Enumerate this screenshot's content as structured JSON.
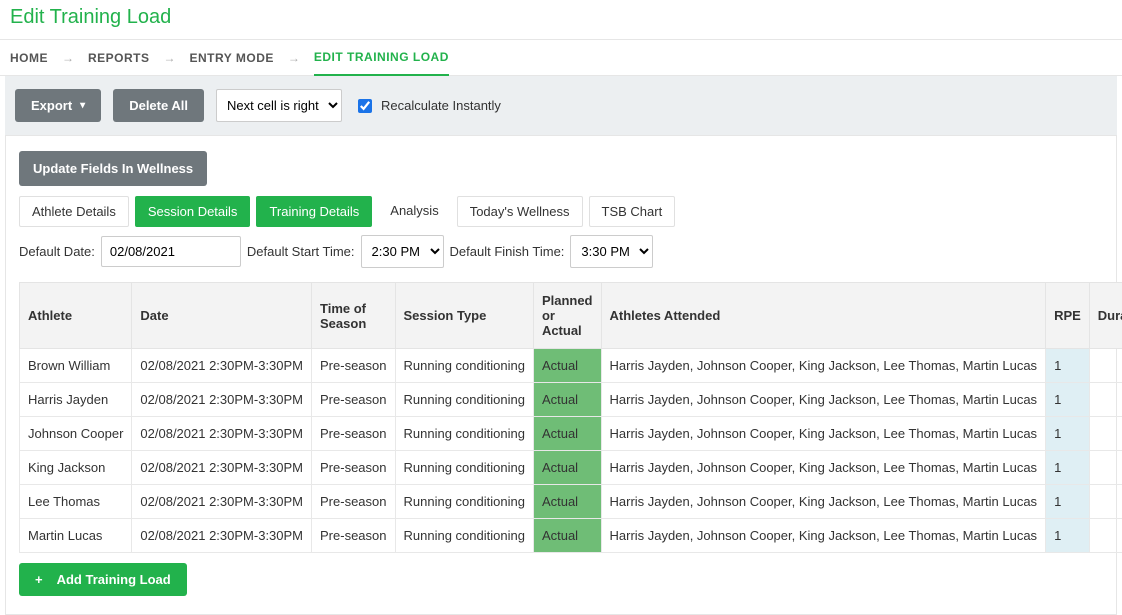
{
  "page_title": "Edit Training Load",
  "breadcrumb": {
    "home": "HOME",
    "reports": "REPORTS",
    "entry_mode": "ENTRY MODE",
    "edit": "EDIT TRAINING LOAD"
  },
  "toolbar": {
    "export_label": "Export",
    "delete_all_label": "Delete All",
    "next_cell_option": "Next cell is right",
    "recalc_label": "Recalculate Instantly"
  },
  "panel": {
    "update_btn": "Update Fields In Wellness",
    "tabs": {
      "athlete_details": "Athlete Details",
      "session_details": "Session Details",
      "training_details": "Training Details",
      "analysis": "Analysis",
      "today_wellness": "Today's Wellness",
      "tsb_chart": "TSB Chart"
    },
    "defaults": {
      "date_label": "Default Date:",
      "date_value": "02/08/2021",
      "start_label": "Default Start Time:",
      "start_value": "2:30 PM",
      "finish_label": "Default Finish Time:",
      "finish_value": "3:30 PM"
    }
  },
  "table": {
    "headers": {
      "athlete": "Athlete",
      "date": "Date",
      "time_of_season": "Time of Season",
      "session_type": "Session Type",
      "planned_actual": "Planned or Actual",
      "athletes_attended": "Athletes Attended",
      "rpe": "RPE",
      "duration": "Duration"
    },
    "rows": [
      {
        "athlete": "Brown William",
        "date": "02/08/2021 2:30PM-3:30PM",
        "tos": "Pre-season",
        "stype": "Running conditioning",
        "pa": "Actual",
        "att": "Harris Jayden, Johnson Cooper, King Jackson, Lee Thomas, Martin Lucas",
        "rpe": "1",
        "dur": ""
      },
      {
        "athlete": "Harris Jayden",
        "date": "02/08/2021 2:30PM-3:30PM",
        "tos": "Pre-season",
        "stype": "Running conditioning",
        "pa": "Actual",
        "att": "Harris Jayden, Johnson Cooper, King Jackson, Lee Thomas, Martin Lucas",
        "rpe": "1",
        "dur": ""
      },
      {
        "athlete": "Johnson Cooper",
        "date": "02/08/2021 2:30PM-3:30PM",
        "tos": "Pre-season",
        "stype": "Running conditioning",
        "pa": "Actual",
        "att": "Harris Jayden, Johnson Cooper, King Jackson, Lee Thomas, Martin Lucas",
        "rpe": "1",
        "dur": ""
      },
      {
        "athlete": "King Jackson",
        "date": "02/08/2021 2:30PM-3:30PM",
        "tos": "Pre-season",
        "stype": "Running conditioning",
        "pa": "Actual",
        "att": "Harris Jayden, Johnson Cooper, King Jackson, Lee Thomas, Martin Lucas",
        "rpe": "1",
        "dur": ""
      },
      {
        "athlete": "Lee Thomas",
        "date": "02/08/2021 2:30PM-3:30PM",
        "tos": "Pre-season",
        "stype": "Running conditioning",
        "pa": "Actual",
        "att": "Harris Jayden, Johnson Cooper, King Jackson, Lee Thomas, Martin Lucas",
        "rpe": "1",
        "dur": ""
      },
      {
        "athlete": "Martin Lucas",
        "date": "02/08/2021 2:30PM-3:30PM",
        "tos": "Pre-season",
        "stype": "Running conditioning",
        "pa": "Actual",
        "att": "Harris Jayden, Johnson Cooper, King Jackson, Lee Thomas, Martin Lucas",
        "rpe": "1",
        "dur": ""
      }
    ]
  },
  "add_btn": "Add Training Load"
}
